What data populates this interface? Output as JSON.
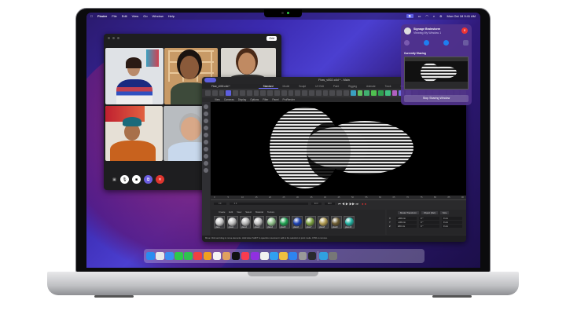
{
  "menubar": {
    "apple": "",
    "app": "Finder",
    "items": [
      "File",
      "Edit",
      "View",
      "Go",
      "Window",
      "Help"
    ],
    "clock": "Mon Oct 18  9:41 AM"
  },
  "facetime": {
    "grid_label": "Grid",
    "participants": [
      "Participant 1",
      "Participant 2",
      "Participant 3",
      "Participant 4",
      "Participant 5"
    ]
  },
  "share_panel": {
    "name": "Signage Brainstorm",
    "subtitle": "Viewing My Window 1",
    "section": "Currently Sharing",
    "stop": "Stop Sharing Window"
  },
  "c4d": {
    "title": "Flow_v002.c4d * - Main",
    "doc_tab": "Flow_v002.c4d *",
    "tabs": [
      "Standard",
      "Model",
      "Sculpt",
      "UV Edit",
      "Paint",
      "Rigging",
      "Animate",
      "Track",
      "Script"
    ],
    "menus": [
      "View",
      "Cameras",
      "Display",
      "Options",
      "Filter",
      "Panel",
      "ProRender"
    ],
    "timeline_ticks": [
      "0",
      "5",
      "10",
      "15",
      "20",
      "25",
      "30",
      "35",
      "40",
      "45",
      "50",
      "55",
      "60",
      "65",
      "70",
      "75",
      "80",
      "85",
      "90"
    ],
    "frame_start": "0 F",
    "frame_cur": "0 F",
    "frame_end": "90 F",
    "frame_max": "90 F",
    "mat_menus": [
      "Create",
      "Edit",
      "View",
      "Select",
      "Material",
      "Texture"
    ],
    "materials": [
      {
        "name": "glass",
        "color": "#c8c8c8"
      },
      {
        "name": "glass1",
        "color": "#bdbdbd"
      },
      {
        "name": "glass2",
        "color": "#b5b5b5"
      },
      {
        "name": "glass3",
        "color": "#c0c0c0"
      },
      {
        "name": "glass4",
        "color": "#8fbf8a"
      },
      {
        "name": "glass5",
        "color": "#1fa050"
      },
      {
        "name": "glass6",
        "color": "#1a3fb0"
      },
      {
        "name": "glass7",
        "color": "#7aa040"
      },
      {
        "name": "glass8",
        "color": "#b09a50"
      },
      {
        "name": "glass9",
        "color": "#6a5a30"
      },
      {
        "name": "glass10",
        "color": "#20b0a0"
      }
    ],
    "attr_dropdowns": [
      "Model Transform",
      "Object (Rel)",
      "Size"
    ],
    "coords": [
      {
        "axis": "X",
        "pos": "-200 cm",
        "rot": "0 °",
        "size": "0 cm"
      },
      {
        "axis": "Y",
        "pos": "-100 cm",
        "rot": "0 °",
        "size": "0 cm"
      },
      {
        "axis": "Z",
        "pos": "200 cm",
        "rot": "0 °",
        "size": "0 cm"
      }
    ],
    "status": "Move: Click and drag to move elements. Hold down SHIFT to quantize movement / add to the selection in point mode, CTRL to remove."
  },
  "accent": "#5d5fe0"
}
